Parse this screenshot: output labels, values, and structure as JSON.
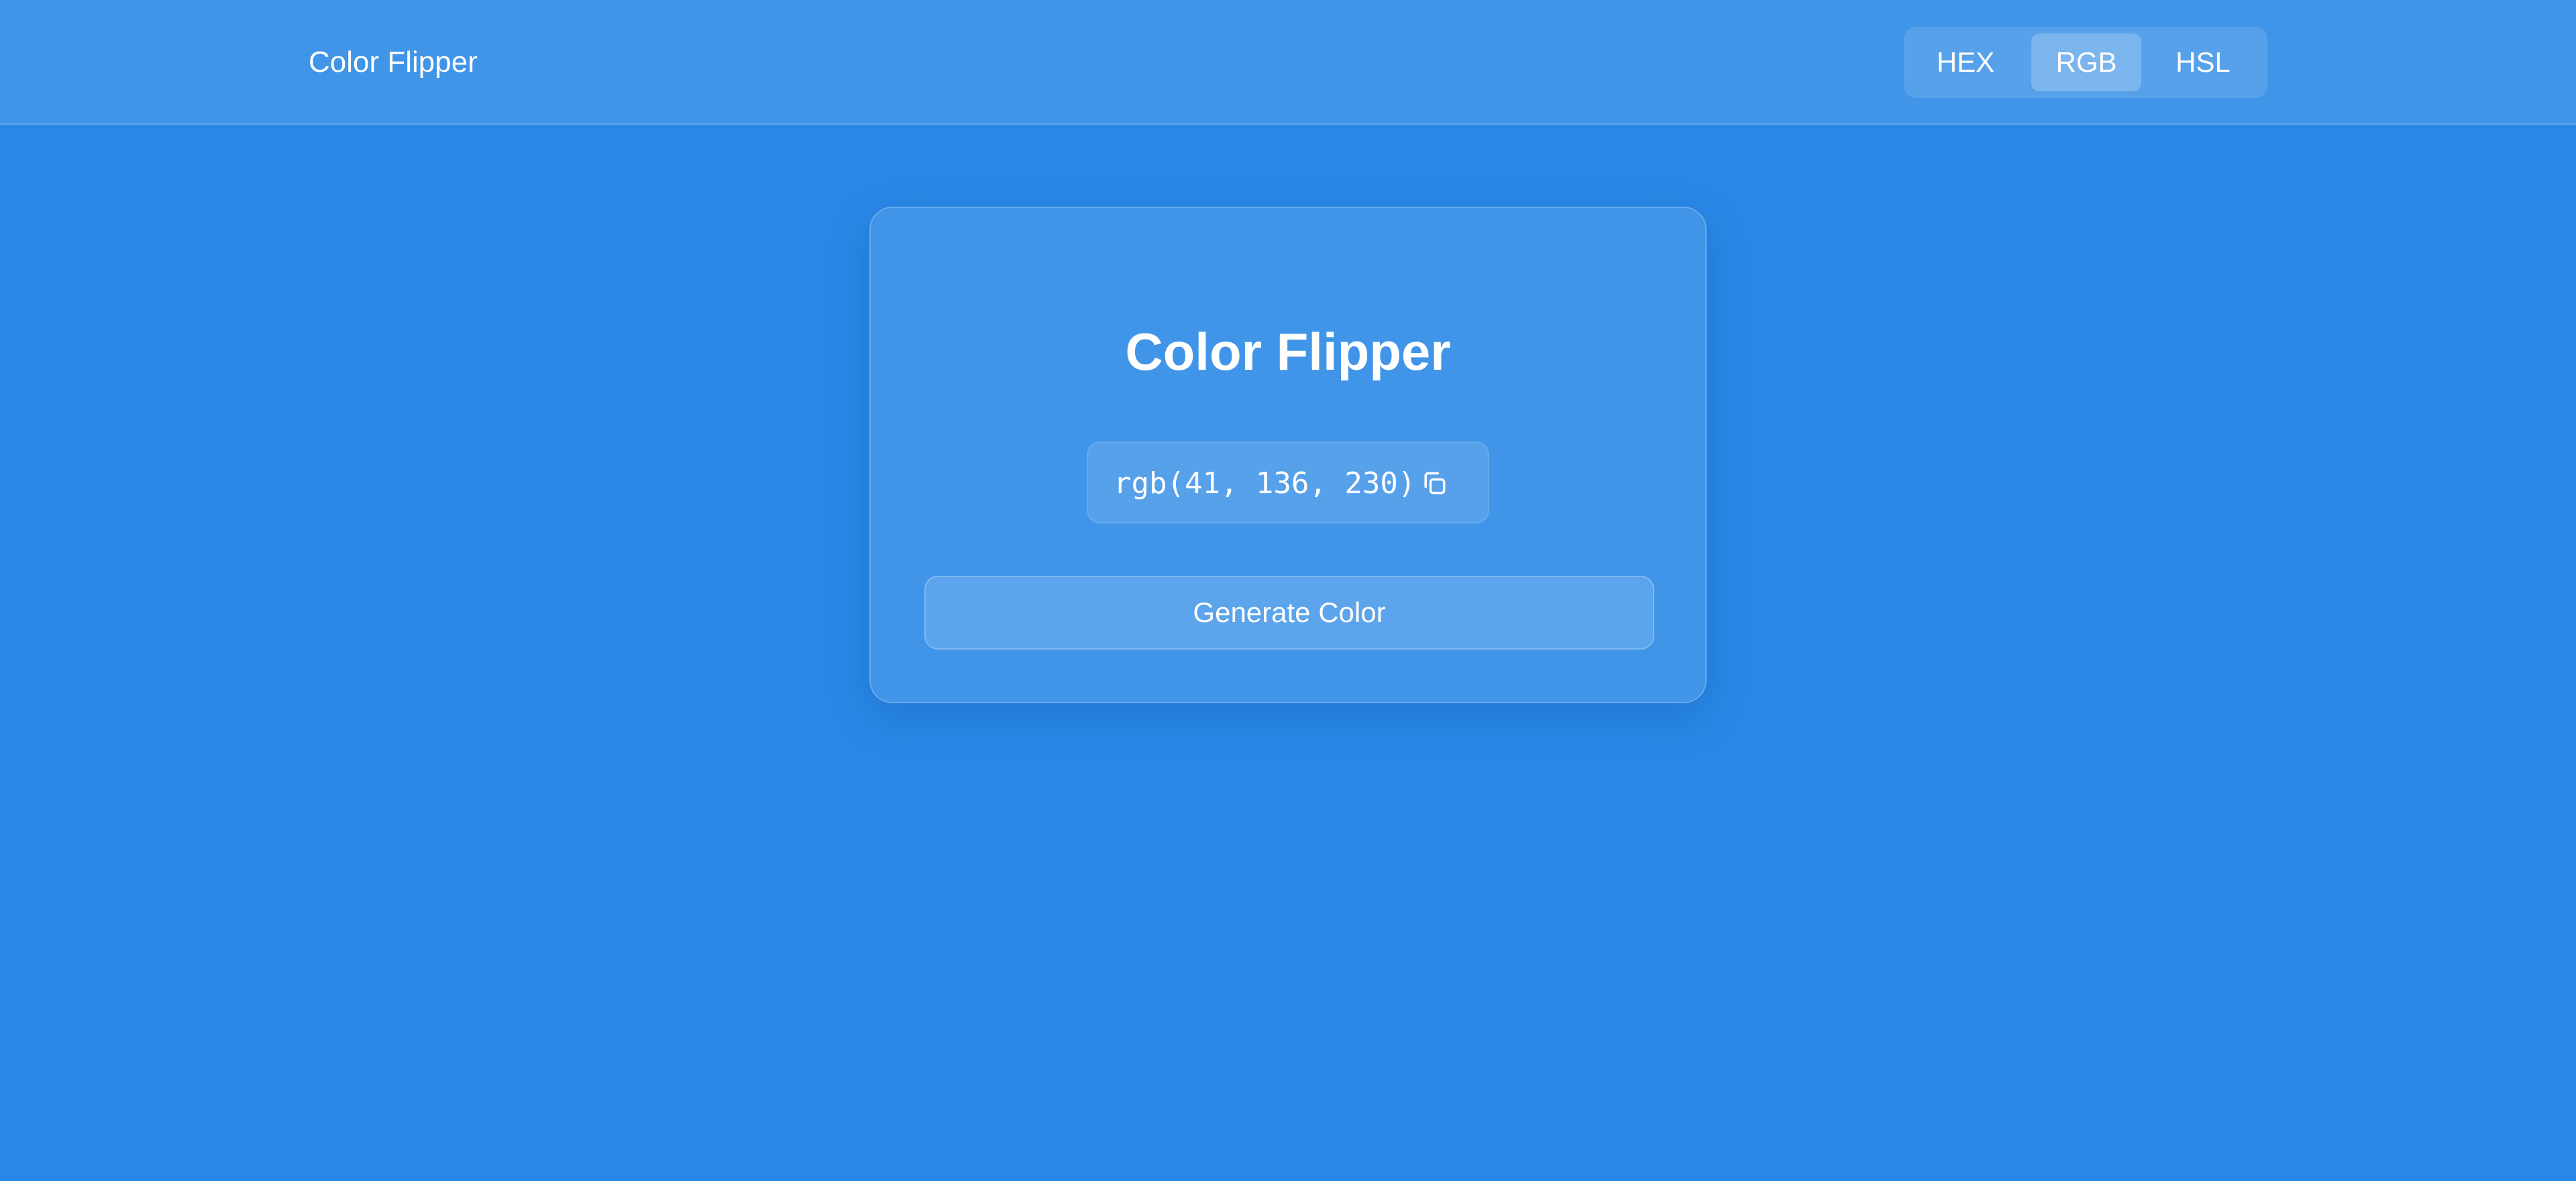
{
  "header": {
    "brand": "Color Flipper",
    "formats": [
      {
        "label": "HEX",
        "active": false
      },
      {
        "label": "RGB",
        "active": true
      },
      {
        "label": "HSL",
        "active": false
      }
    ]
  },
  "card": {
    "title": "Color Flipper",
    "color_value": "rgb(41, 136, 230)",
    "copy_icon": "copy-icon",
    "generate_label": "Generate Color"
  },
  "colors": {
    "background": "#2988e6",
    "text": "#ffffff"
  }
}
